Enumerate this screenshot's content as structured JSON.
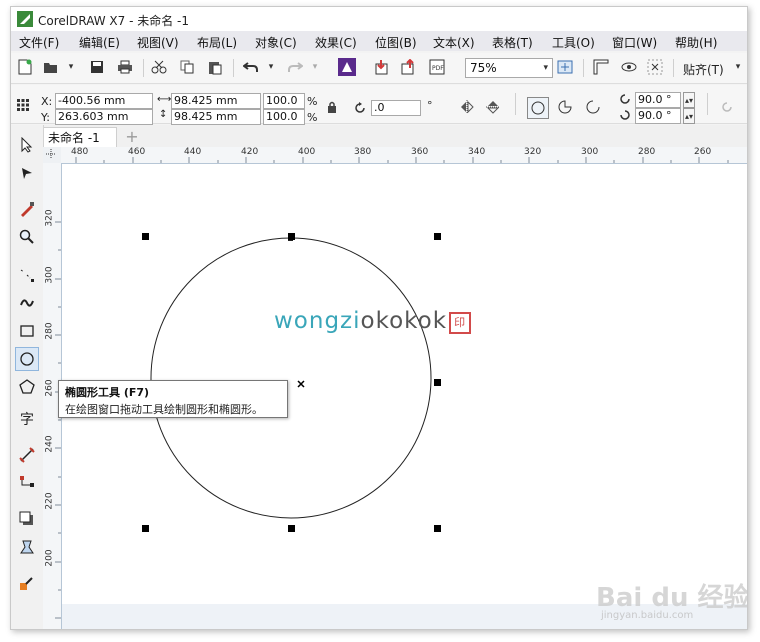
{
  "window": {
    "title": "CorelDRAW X7 - 未命名 -1"
  },
  "menu": [
    "文件(F)",
    "编辑(E)",
    "视图(V)",
    "布局(L)",
    "对象(C)",
    "效果(C)",
    "位图(B)",
    "文本(X)",
    "表格(T)",
    "工具(O)",
    "窗口(W)",
    "帮助(H)"
  ],
  "toolbar": {
    "zoom_value": "75%",
    "snap_label": "贴齐(T)"
  },
  "propertybar": {
    "x_label": "X:",
    "x_value": "-400.56 mm",
    "y_label": "Y:",
    "y_value": "263.603 mm",
    "width_value": "98.425 mm",
    "height_value": "98.425 mm",
    "scale_x": "100.0",
    "scale_y": "100.0",
    "percent": "%",
    "angle_value": ".0",
    "degree": "°",
    "start_angle": "90.0 °",
    "end_angle": "90.0 °"
  },
  "document_tab": {
    "label": "未命名 -1",
    "add": "+"
  },
  "ruler": {
    "h_ticks": [
      "480",
      "460",
      "440",
      "420",
      "400",
      "380",
      "360",
      "340",
      "320",
      "300",
      "280",
      "260"
    ],
    "v_ticks": [
      "320",
      "300",
      "280",
      "260",
      "240",
      "220",
      "200"
    ]
  },
  "tooltip": {
    "title": "椭圆形工具 (F7)",
    "desc": "在绘图窗口拖动工具绘制圆形和椭圆形。"
  },
  "watermark": {
    "part1": "wongzi",
    "part2": "okokok",
    "seal": "印"
  },
  "overlay": {
    "brand": "Bai du 经验",
    "url": "jingyan.baidu.com"
  },
  "icons": [
    "new-icon",
    "open-icon",
    "save-icon",
    "print-icon",
    "cut-icon",
    "copy-icon",
    "paste-icon",
    "undo-icon",
    "redo-icon",
    "launcher-icon",
    "import-icon",
    "export-icon",
    "publish-pdf-icon",
    "fullscreen-icon",
    "rulers-icon",
    "guidelines-icon",
    "snap-icon"
  ],
  "colors": {
    "accent": "#3aa6b9",
    "selection": "#000000",
    "menubar": "#e9e9ee"
  }
}
